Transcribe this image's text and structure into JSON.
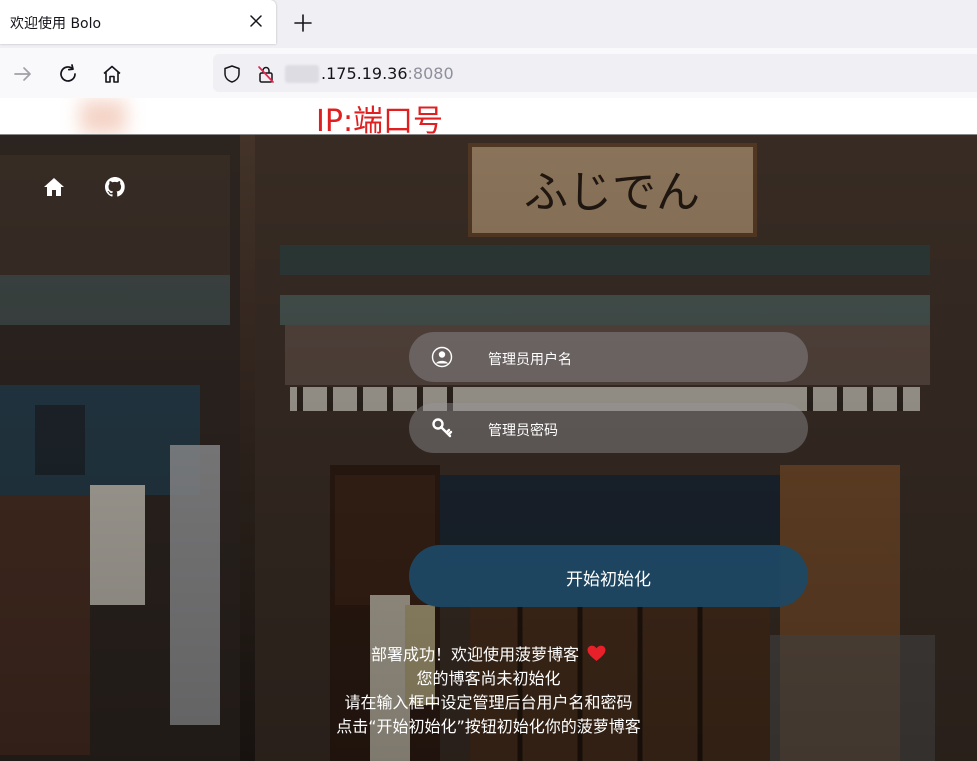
{
  "browser": {
    "tab_title": "欢迎使用 Bolo",
    "url_host": ".175.19.36",
    "url_port": ":8080"
  },
  "annotation": {
    "label": "IP:端口号",
    "color": "#e02020"
  },
  "setup_form": {
    "username_placeholder": "管理员用户名",
    "password_placeholder": "管理员密码",
    "start_button_label": "开始初始化"
  },
  "message": {
    "line1": "部署成功！欢迎使用菠萝博客",
    "line2": "您的博客尚未初始化",
    "line3": "请在输入框中设定管理后台用户名和密码",
    "line4": "点击“开始初始化”按钮初始化你的菠萝博客"
  },
  "icons": [
    "close-icon",
    "plus-icon",
    "forward-icon",
    "reload-icon",
    "home-icon",
    "shield-icon",
    "insecure-lock-icon",
    "github-icon",
    "user-icon",
    "key-icon",
    "heart-icon"
  ],
  "colors": {
    "button": "#1e4864",
    "heart": "#e8202a"
  }
}
